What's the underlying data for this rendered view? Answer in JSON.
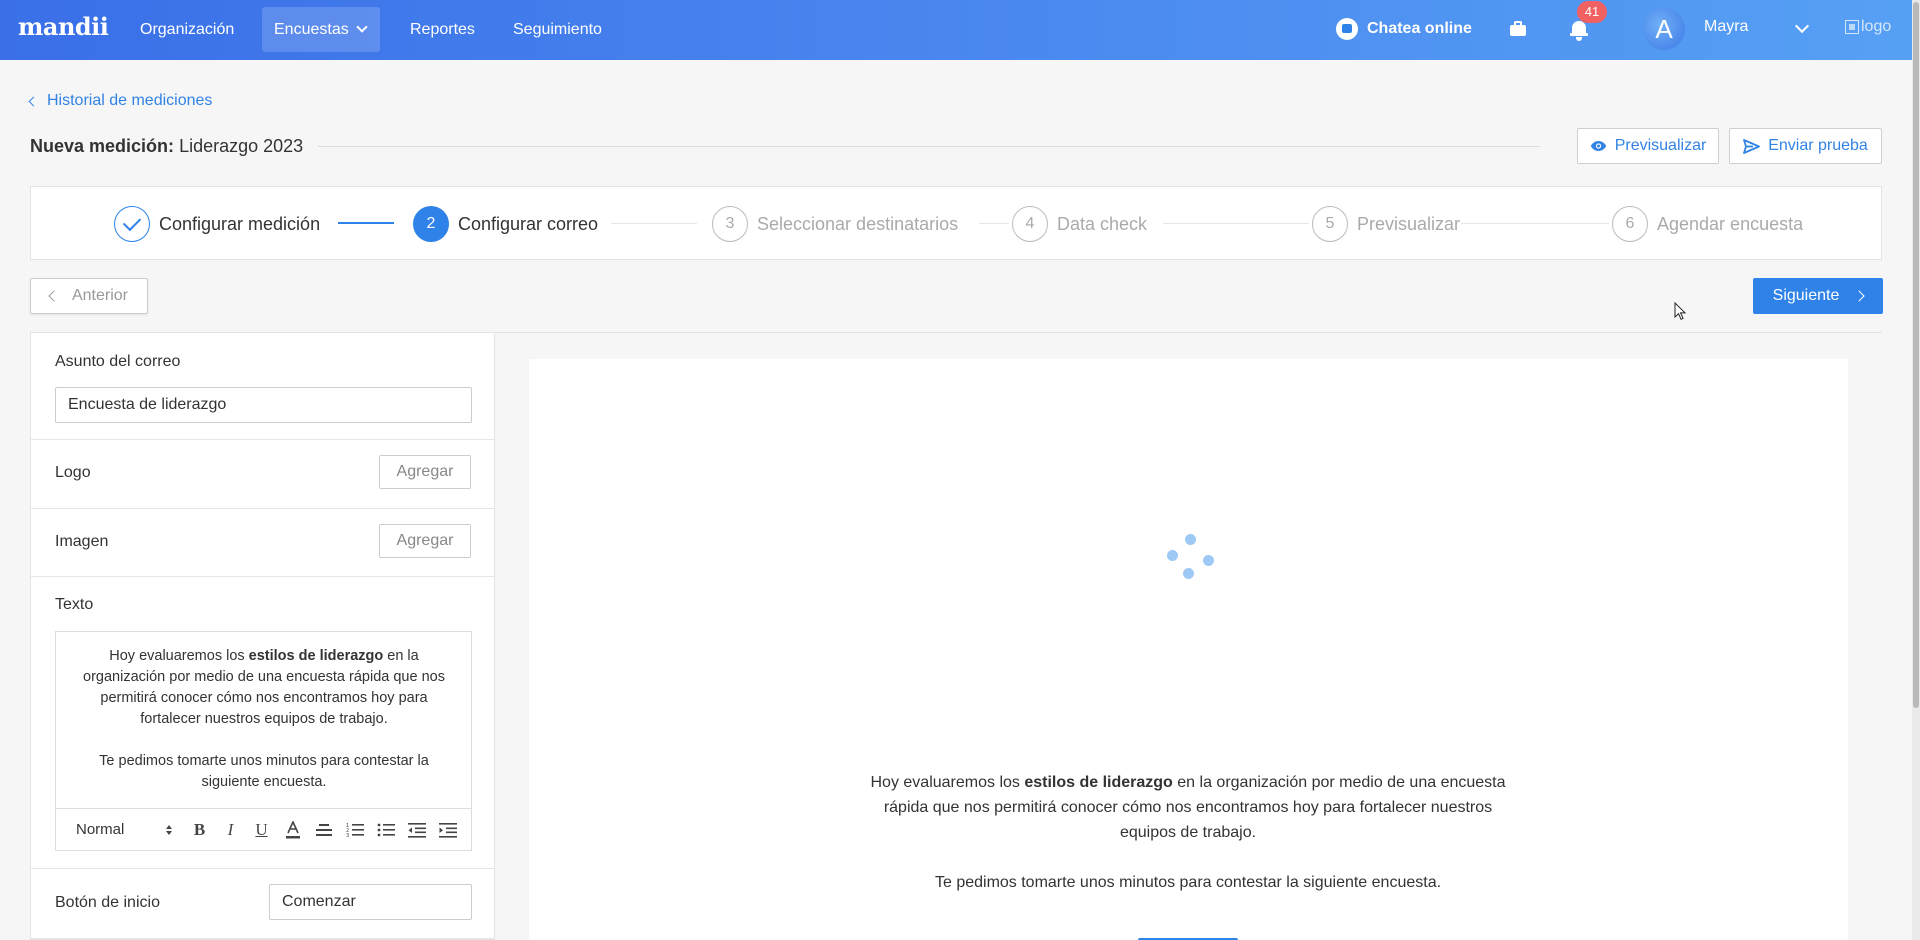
{
  "nav": {
    "brand": "mandii",
    "items": [
      "Organización",
      "Encuestas",
      "Reportes",
      "Seguimiento"
    ],
    "chat_label": "Chatea online",
    "notifications_count": "41",
    "avatar_letter": "A",
    "user_name": "Mayra",
    "logo_alt": "logo"
  },
  "header": {
    "back_link": "Historial de mediciones",
    "title_prefix": "Nueva medición:",
    "title_name": "Liderazgo 2023",
    "preview_button": "Previsualizar",
    "test_button": "Enviar prueba"
  },
  "stepper": {
    "steps": [
      {
        "number": "1",
        "label": "Configurar medición",
        "state": "done"
      },
      {
        "number": "2",
        "label": "Configurar correo",
        "state": "active"
      },
      {
        "number": "3",
        "label": "Seleccionar destinatarios",
        "state": "pending"
      },
      {
        "number": "4",
        "label": "Data check",
        "state": "pending"
      },
      {
        "number": "5",
        "label": "Previsualizar",
        "state": "pending"
      },
      {
        "number": "6",
        "label": "Agendar encuesta",
        "state": "pending"
      }
    ]
  },
  "actions": {
    "prev_label": "Anterior",
    "next_label": "Siguiente"
  },
  "editor": {
    "subject_label": "Asunto del correo",
    "subject_value": "Encuesta de liderazgo",
    "logo_label": "Logo",
    "image_label": "Imagen",
    "add_label": "Agregar",
    "text_label": "Texto",
    "body_p1_before": "Hoy evaluaremos los ",
    "body_p1_bold": "estilos de liderazgo",
    "body_p1_after": " en la organización por medio de una encuesta rápida que nos permitirá conocer cómo nos encontramos hoy para fortalecer nuestros equipos de trabajo.",
    "body_p2": "Te pedimos tomarte unos minutos para contestar la siguiente encuesta.",
    "format_value": "Normal",
    "start_button_label": "Botón de inicio",
    "start_button_value": "Comenzar"
  },
  "colors": {
    "accent": "#2f83e8",
    "nav_gradient_start": "#3a6fe8",
    "nav_gradient_end": "#56a0f4",
    "badge": "#f26161"
  },
  "icons": [
    "chevron-left-icon",
    "chevron-right-icon",
    "chevron-down-icon",
    "eye-icon",
    "send-icon",
    "check-icon",
    "chat-icon",
    "briefcase-icon",
    "bell-icon",
    "spinner-icon"
  ]
}
